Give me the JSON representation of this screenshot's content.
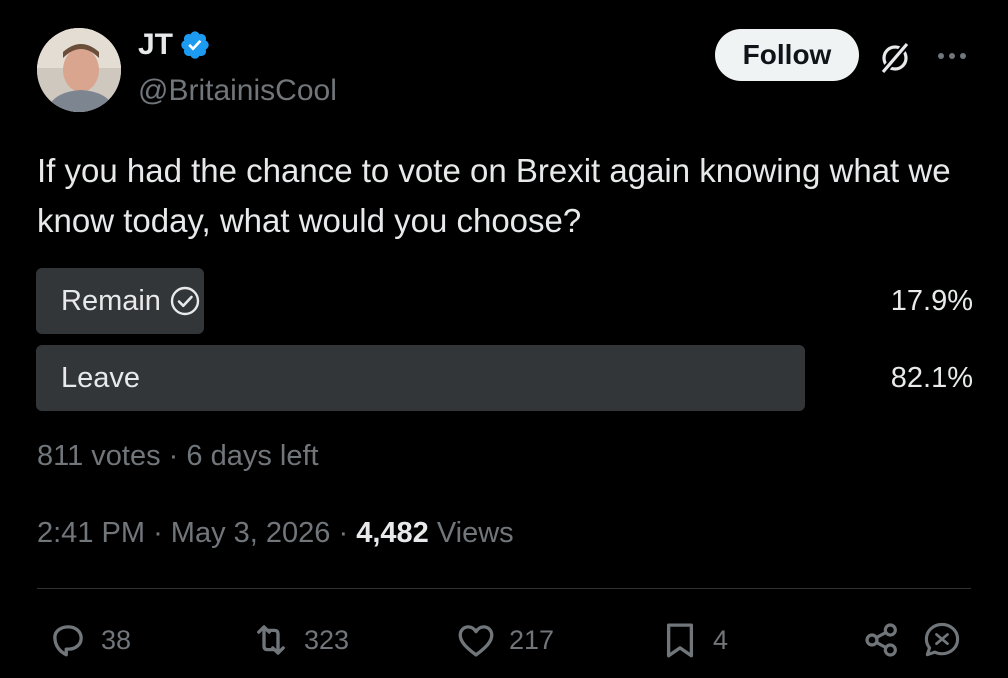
{
  "author": {
    "display_name": "JT",
    "handle": "@BritainisCool",
    "verified": true,
    "verified_color": "#1d9bf0"
  },
  "header": {
    "follow_label": "Follow"
  },
  "tweet": {
    "text": "If you had the chance to vote on Brexit again knowing what we know today, what would you choose?"
  },
  "poll": {
    "options": [
      {
        "label": "Remain",
        "percent": "17.9%",
        "fraction": 0.179,
        "selected": true
      },
      {
        "label": "Leave",
        "percent": "82.1%",
        "fraction": 0.821,
        "selected": false
      }
    ],
    "votes": "811 votes",
    "time_left": "6 days left",
    "separator": "·"
  },
  "meta": {
    "time": "2:41 PM",
    "date": "May 3, 2026",
    "views_count": "4,482",
    "views_label": "Views",
    "separator": "·"
  },
  "actions": {
    "replies": "38",
    "reposts": "323",
    "likes": "217",
    "bookmarks": "4"
  },
  "icons": {
    "verified": "verified-badge-icon",
    "grok": "grok-icon",
    "more": "more-icon",
    "check": "check-circle-icon",
    "reply": "reply-icon",
    "repost": "repost-icon",
    "like": "heart-icon",
    "bookmark": "bookmark-icon",
    "share": "share-icon",
    "chat": "chat-icon"
  },
  "colors": {
    "background": "#000000",
    "text": "#e7e9ea",
    "muted": "#71767b",
    "poll_bar": "#333639",
    "follow_bg": "#eff3f4"
  }
}
